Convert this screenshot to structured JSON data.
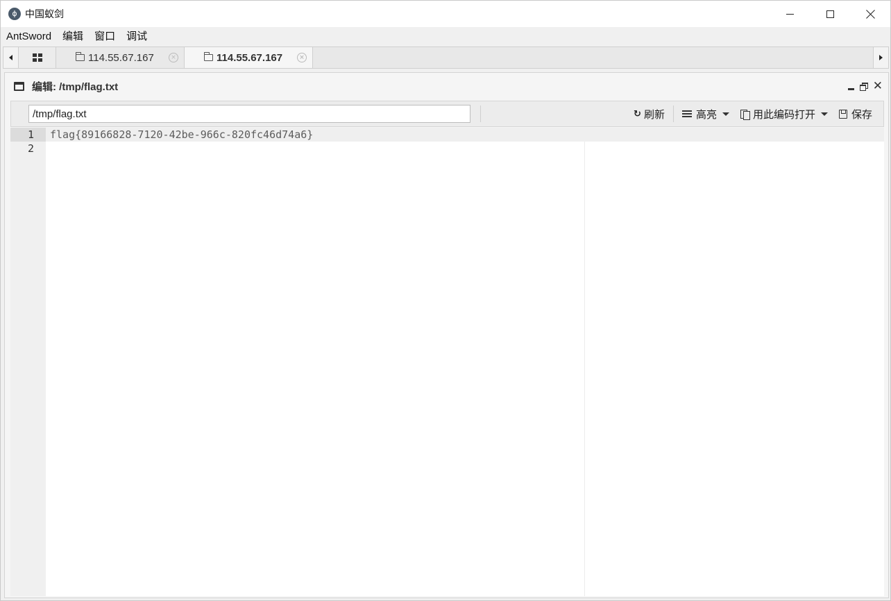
{
  "window": {
    "title": "中国蚁剑",
    "logo_glyph": "ϕ"
  },
  "menu": [
    "AntSword",
    "编辑",
    "窗口",
    "调试"
  ],
  "tabs": [
    {
      "label": "114.55.67.167",
      "active": false
    },
    {
      "label": "114.55.67.167",
      "active": true
    }
  ],
  "panel": {
    "title": "编辑: /tmp/flag.txt"
  },
  "toolbar": {
    "path_value": "/tmp/flag.txt",
    "refresh_label": "刷新",
    "highlight_label": "高亮",
    "encoding_label": "用此编码打开",
    "save_label": "保存",
    "refresh_glyph": "↻"
  },
  "editor": {
    "line_numbers": [
      "1",
      "2"
    ],
    "lines": [
      "flag{89166828-7120-42be-966c-820fc46d74a6}",
      ""
    ]
  },
  "icons": {
    "close_glyph": "×",
    "panel_close_glyph": "✕"
  }
}
